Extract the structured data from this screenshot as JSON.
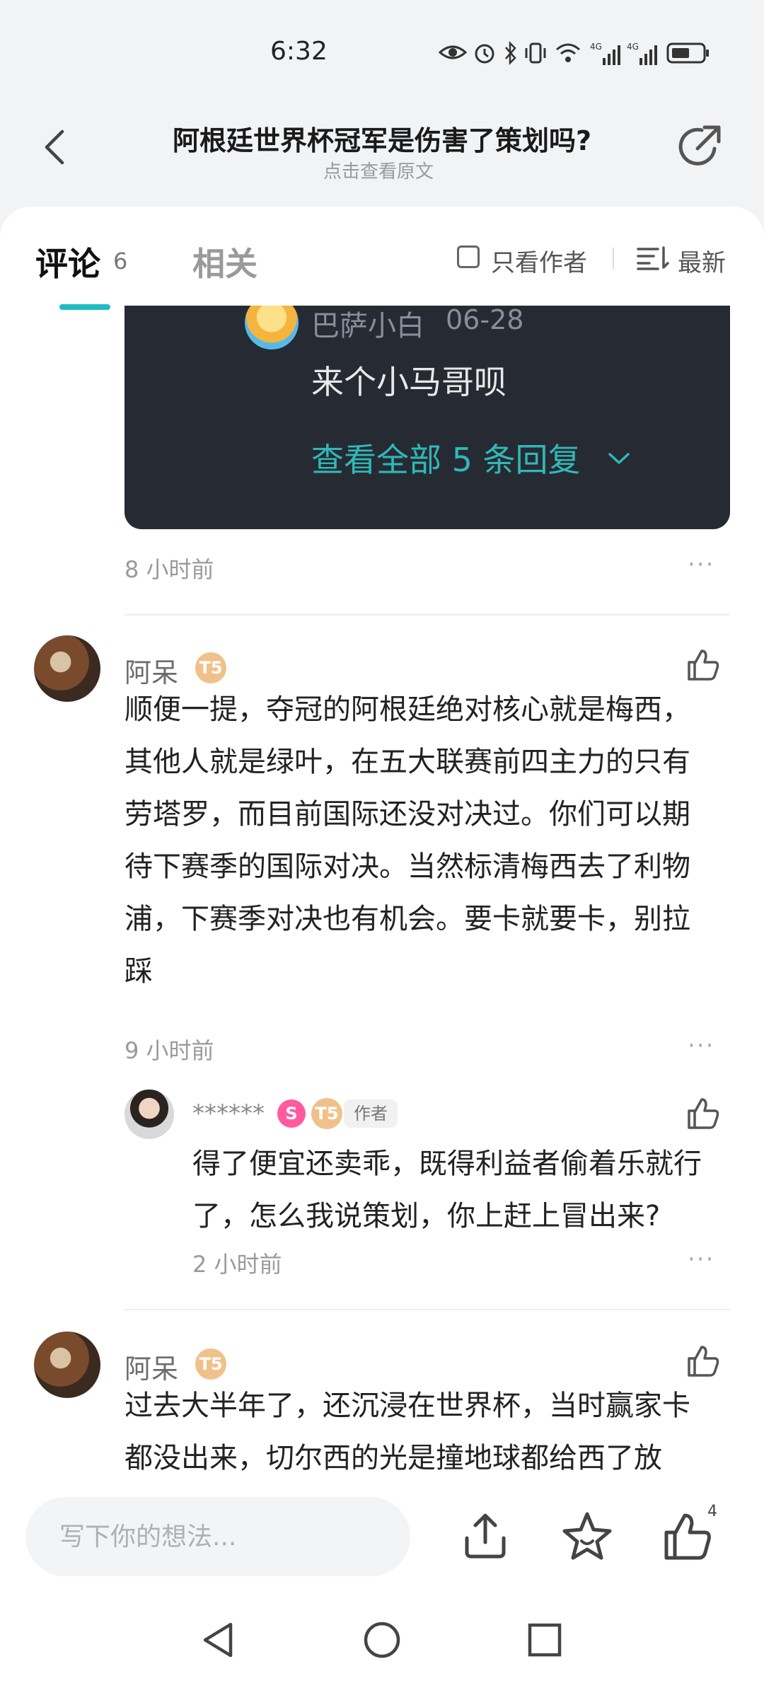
{
  "status_bar": {
    "time": "6:32",
    "icons": [
      "eye-icon",
      "alarm-icon",
      "bluetooth-icon",
      "vibrate-icon",
      "wifi-icon",
      "signal-4g-icon",
      "signal-4g-icon",
      "battery-icon"
    ],
    "signal_label_1": "4G",
    "signal_label_2": "4G"
  },
  "header": {
    "title": "阿根廷世界杯冠军是伤害了策划吗?",
    "subtitle": "点击查看原文"
  },
  "tabs": {
    "comments_label": "评论",
    "comments_count": "6",
    "related_label": "相关",
    "author_only_label": "只看作者",
    "sort_label": "最新"
  },
  "reply_card": {
    "name": "巴萨小白",
    "date": "06-28",
    "text": "来个小马哥呗",
    "view_all": "查看全部 5 条回复"
  },
  "comments": [
    {
      "time": "8 小时前",
      "more": "···"
    },
    {
      "name": "阿呆",
      "badge": "T5",
      "lines": [
        "顺便一提，夺冠的阿根廷绝对核心就是梅西，",
        "其他人就是绿叶，在五大联赛前四主力的只有",
        "劳塔罗，而目前国际还没对决过。你们可以期",
        "待下赛季的国际对决。当然标清梅西去了利物",
        "浦，下赛季对决也有机会。要卡就要卡，别拉",
        "踩"
      ],
      "time": "9 小时前",
      "more": "···",
      "reply": {
        "name": "******",
        "badge_s": "S",
        "badge_t": "T5",
        "author_tag": "作者",
        "lines": [
          "得了便宜还卖乖，既得利益者偷着乐就行",
          "了，怎么我说策划，你上赶上冒出来?"
        ],
        "time": "2 小时前",
        "more": "···"
      }
    },
    {
      "name": "阿呆",
      "badge": "T5",
      "lines": [
        "过去大半年了，还沉浸在世界杯，当时赢家卡",
        "都没出来，切尔西的光是撞地球都给西了放"
      ]
    }
  ],
  "bottom_bar": {
    "input_placeholder": "写下你的想法...",
    "like_count": "4"
  },
  "colors": {
    "accent": "#1fbcc4",
    "card_bg": "#262a33",
    "link": "#2fb8b8"
  }
}
